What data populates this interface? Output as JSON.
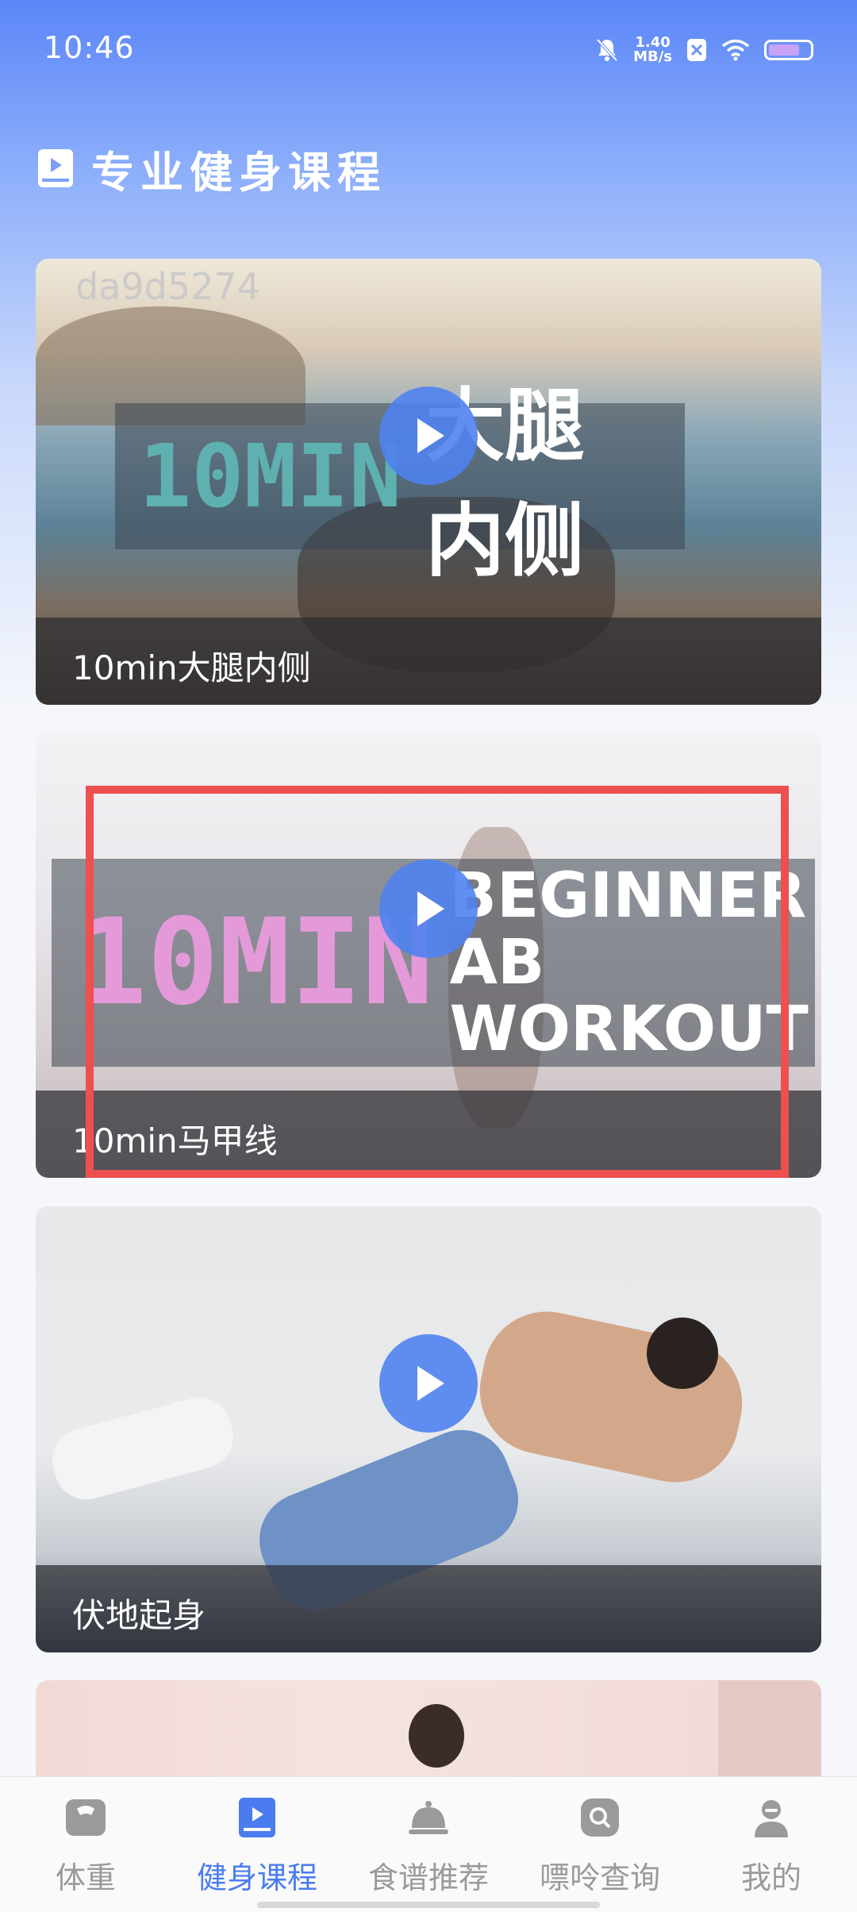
{
  "status": {
    "time": "10:46",
    "speed_value": "1.40",
    "speed_unit": "MB/s"
  },
  "header": {
    "title": "专业健身课程"
  },
  "watermark": "da9d5274",
  "cards": [
    {
      "caption": "10min大腿内侧",
      "thumb_ten": "10MIN",
      "thumb_text": "大腿内侧"
    },
    {
      "caption": "10min马甲线",
      "thumb_ten": "10MIN",
      "thumb_line1": "BEGINNER AB",
      "thumb_line2": "WORKOUT"
    },
    {
      "caption": "伏地起身"
    }
  ],
  "tabs": [
    {
      "label": "体重",
      "icon": "scale-icon"
    },
    {
      "label": "健身课程",
      "icon": "course-book-icon",
      "active": true
    },
    {
      "label": "食谱推荐",
      "icon": "cloche-icon"
    },
    {
      "label": "嘌呤查询",
      "icon": "search-icon"
    },
    {
      "label": "我的",
      "icon": "user-icon"
    }
  ],
  "colors": {
    "accent": "#4a7cf0",
    "highlight": "#ee4f4f",
    "tab_inactive": "#9a9a9a"
  }
}
